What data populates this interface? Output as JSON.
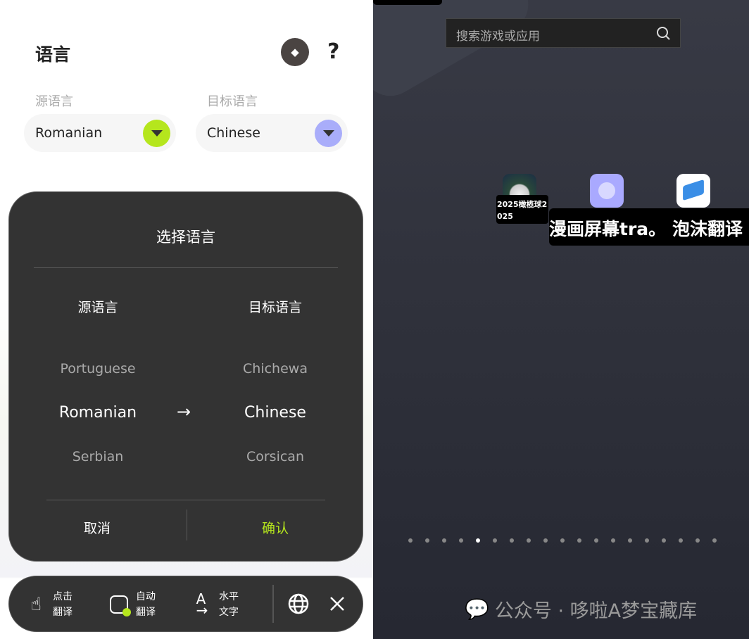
{
  "panel": {
    "title": "语言",
    "source_label": "源语言",
    "target_label": "目标语言",
    "source_value": "Romanian",
    "target_value": "Chinese",
    "source_color": "#b5e61d",
    "target_color": "#a9adfa"
  },
  "dialog": {
    "title": "选择语言",
    "source_header": "源语言",
    "target_header": "目标语言",
    "source_options": [
      "Portuguese",
      "Romanian",
      "Serbian"
    ],
    "target_options": [
      "Chichewa",
      "Chinese",
      "Corsican"
    ],
    "arrow": "→",
    "cancel": "取消",
    "confirm": "确认",
    "confirm_color": "#b5e61d"
  },
  "toolbar": {
    "items": [
      {
        "icon": "tap-icon",
        "line1": "点击",
        "line2": "翻译"
      },
      {
        "icon": "robot-icon",
        "line1": "自动",
        "line2": "翻译"
      },
      {
        "icon": "text-direction-icon",
        "line1": "水平",
        "line2": "文字"
      }
    ]
  },
  "launcher": {
    "search_placeholder": "搜索游戏或应用",
    "apps": [
      {
        "label": "2025橄榄球2025"
      },
      {
        "label": "漫画屏幕tra。"
      },
      {
        "label": "泡沫翻译"
      }
    ],
    "page_count": 19,
    "active_page": 5,
    "watermark": "公众号 · 哆啦A梦宝藏库"
  }
}
